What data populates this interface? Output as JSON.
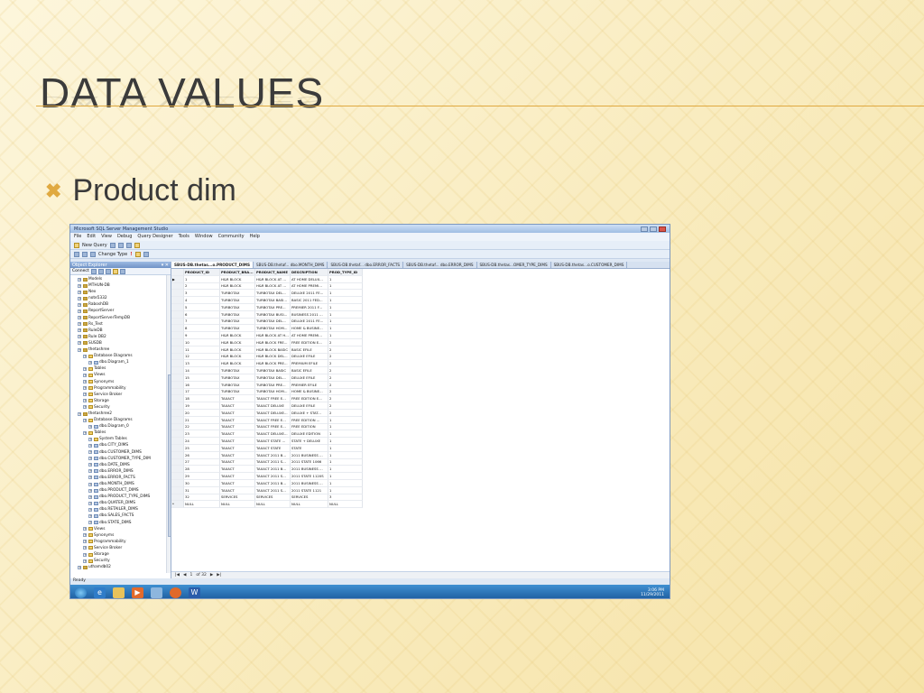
{
  "slide": {
    "title": "DATA VALUES",
    "bullet": "Product dim",
    "bullet_icon": "x-mark-icon",
    "accent": "#e0a940"
  },
  "ssms": {
    "window_title": "Microsoft SQL Server Management Studio",
    "menu": [
      "File",
      "Edit",
      "View",
      "Debug",
      "Query Designer",
      "Tools",
      "Window",
      "Community",
      "Help"
    ],
    "toolbar_new_query": "New Query",
    "toolbar_change_type": "Change Type",
    "explorer_title": "Object Explorer",
    "explorer_connect": "Connect",
    "tree": [
      {
        "label": "Models",
        "level": 2,
        "kind": "db"
      },
      {
        "label": "MTHUN-DB",
        "level": 2,
        "kind": "db"
      },
      {
        "label": "Nex",
        "level": 2,
        "kind": "db"
      },
      {
        "label": "note5332",
        "level": 2,
        "kind": "db"
      },
      {
        "label": "RaboshDB",
        "level": 2,
        "kind": "db"
      },
      {
        "label": "ReportServer",
        "level": 2,
        "kind": "db"
      },
      {
        "label": "ReportServerTempDB",
        "level": 2,
        "kind": "db"
      },
      {
        "label": "Rs_Test",
        "level": 2,
        "kind": "db"
      },
      {
        "label": "RuleDB",
        "level": 2,
        "kind": "db"
      },
      {
        "label": "Rule DB2",
        "level": 2,
        "kind": "db"
      },
      {
        "label": "SUSDB",
        "level": 2,
        "kind": "db"
      },
      {
        "label": "thetashree",
        "level": 2,
        "kind": "db"
      },
      {
        "label": "Database Diagrams",
        "level": 3,
        "kind": "folder"
      },
      {
        "label": "dbo.Diagram_1",
        "level": 4,
        "kind": "tbl"
      },
      {
        "label": "Tables",
        "level": 3,
        "kind": "folder"
      },
      {
        "label": "Views",
        "level": 3,
        "kind": "folder"
      },
      {
        "label": "Synonyms",
        "level": 3,
        "kind": "folder"
      },
      {
        "label": "Programmability",
        "level": 3,
        "kind": "folder"
      },
      {
        "label": "Service Broker",
        "level": 3,
        "kind": "folder"
      },
      {
        "label": "Storage",
        "level": 3,
        "kind": "folder"
      },
      {
        "label": "Security",
        "level": 3,
        "kind": "folder"
      },
      {
        "label": "thetashree2",
        "level": 2,
        "kind": "db"
      },
      {
        "label": "Database Diagrams",
        "level": 3,
        "kind": "folder"
      },
      {
        "label": "dbo.Diagram_0",
        "level": 4,
        "kind": "tbl"
      },
      {
        "label": "Tables",
        "level": 3,
        "kind": "folder"
      },
      {
        "label": "System Tables",
        "level": 4,
        "kind": "folder"
      },
      {
        "label": "dbo.CITY_DIMS",
        "level": 4,
        "kind": "tbl"
      },
      {
        "label": "dbo.CUSTOMER_DIMS",
        "level": 4,
        "kind": "tbl"
      },
      {
        "label": "dbo.CUSTOMER_TYPE_DIM",
        "level": 4,
        "kind": "tbl"
      },
      {
        "label": "dbo.DATE_DIMS",
        "level": 4,
        "kind": "tbl"
      },
      {
        "label": "dbo.ERROR_DIMS",
        "level": 4,
        "kind": "tbl"
      },
      {
        "label": "dbo.ERROR_FACTS",
        "level": 4,
        "kind": "tbl"
      },
      {
        "label": "dbo.MONTH_DIMS",
        "level": 4,
        "kind": "tbl"
      },
      {
        "label": "dbo.PRODUCT_DIMS",
        "level": 4,
        "kind": "tbl"
      },
      {
        "label": "dbo.PRODUCT_TYPE_DIMS",
        "level": 4,
        "kind": "tbl"
      },
      {
        "label": "dbo.QUATER_DIMS",
        "level": 4,
        "kind": "tbl"
      },
      {
        "label": "dbo.RETAILER_DIMS",
        "level": 4,
        "kind": "tbl"
      },
      {
        "label": "dbo.SALES_FACTS",
        "level": 4,
        "kind": "tbl"
      },
      {
        "label": "dbo.STATE_DIMS",
        "level": 4,
        "kind": "tbl"
      },
      {
        "label": "Views",
        "level": 3,
        "kind": "folder"
      },
      {
        "label": "Synonyms",
        "level": 3,
        "kind": "folder"
      },
      {
        "label": "Programmability",
        "level": 3,
        "kind": "folder"
      },
      {
        "label": "Service Broker",
        "level": 3,
        "kind": "folder"
      },
      {
        "label": "Storage",
        "level": 3,
        "kind": "folder"
      },
      {
        "label": "Security",
        "level": 3,
        "kind": "folder"
      },
      {
        "label": "uthamdb02",
        "level": 2,
        "kind": "db"
      }
    ],
    "tabs": [
      "SBUS-DB.thetas...o.PRODUCT_DIMS",
      "SBUS-DB.thetaf... dbo.MONTH_DIMS",
      "SBUS-DB.thetaf... dbo.ERROR_FACTS",
      "SBUS-DB.thetaf... dbo.ERROR_DIMS",
      "SBUS-DB.thetas...OMER_TYPE_DIMS",
      "SBUS-DB.thetas...o.CUSTOMER_DIMS"
    ],
    "columns": [
      "PRODUCT_ID",
      "PRODUCT_BRA...",
      "PRODUCT_NAME",
      "DESCRIPTION",
      "PROD_TYPE_ID"
    ],
    "rows": [
      [
        "1",
        "H&R BLOCK",
        "H&R BLOCK AT ...",
        "AT HOME DELUX...",
        "1"
      ],
      [
        "2",
        "H&R BLOCK",
        "H&R BLOCK AT ...",
        "AT HOME PREMI...",
        "1"
      ],
      [
        "3",
        "TURBOTAX",
        "TURBOTAX DEL...",
        "DELUXE 2011 FE...",
        "1"
      ],
      [
        "4",
        "TURBOTAX",
        "TURBOTAX BASI...",
        "BASIC 2011 FED...",
        "1"
      ],
      [
        "5",
        "TURBOTAX",
        "TURBOTAX PRE...",
        "PREMIER 2011 F...",
        "1"
      ],
      [
        "6",
        "TURBOTAX",
        "TURBOTAX BUSI...",
        "BUSINESS 2011 ...",
        "1"
      ],
      [
        "7",
        "TURBOTAX",
        "TURBOTAX DEL...",
        "DELUXE 2011 FE...",
        "1"
      ],
      [
        "8",
        "TURBOTAX",
        "TURBOTAX HOM...",
        "HOME & BUSINE...",
        "1"
      ],
      [
        "9",
        "H&R BLOCK",
        "H&R BLOCK AT H...",
        "AT HOME PREMI...",
        "1"
      ],
      [
        "10",
        "H&R BLOCK",
        "H&R BLOCK FRE...",
        "FREE EDITION E...",
        "2"
      ],
      [
        "11",
        "H&R BLOCK",
        "H&R BLOCK BASIC",
        "BASIC EFILE",
        "2"
      ],
      [
        "12",
        "H&R BLOCK",
        "H&R BLOCK DEL...",
        "DELUXE EFILE",
        "2"
      ],
      [
        "13",
        "H&R BLOCK",
        "H&R BLOCK PRE...",
        "PREMIUM EFILE",
        "2"
      ],
      [
        "14",
        "TURBOTAX",
        "TURBOTAX BASIC",
        "BASIC EFILE",
        "2"
      ],
      [
        "15",
        "TURBOTAX",
        "TURBOTAX DEL...",
        "DELUXE EFILE",
        "2"
      ],
      [
        "16",
        "TURBOTAX",
        "TURBOTAX PRE...",
        "PREMIER EFILE",
        "2"
      ],
      [
        "17",
        "TURBOTAX",
        "TURBOTAX HOM...",
        "HOME & BUSINE...",
        "2"
      ],
      [
        "18",
        "TAXACT",
        "TAXACT FREE E...",
        "FREE EDITION E...",
        "2"
      ],
      [
        "19",
        "TAXACT",
        "TAXACT DELUXE",
        "DELUXE EFILE",
        "2"
      ],
      [
        "20",
        "TAXACT",
        "TAXACT DELUXE...",
        "DELUXE + STAT...",
        "2"
      ],
      [
        "21",
        "TAXACT",
        "TAXACT FREE E...",
        "FREE EDITION ...",
        "1"
      ],
      [
        "22",
        "TAXACT",
        "TAXACT FREE E...",
        "FREE EDITION",
        "1"
      ],
      [
        "23",
        "TAXACT",
        "TAXACT DELUXE...",
        "DELUXE EDITION",
        "1"
      ],
      [
        "24",
        "TAXACT",
        "TAXACT STATE ...",
        "STATE + DELUXE",
        "1"
      ],
      [
        "25",
        "TAXACT",
        "TAXACT STATE",
        "STATE",
        "1"
      ],
      [
        "26",
        "TAXACT",
        "TAXACT 2011 B...",
        "2011 BUSINESS ...",
        "1"
      ],
      [
        "27",
        "TAXACT",
        "TAXACT 2011 S...",
        "2011 STATE 1066",
        "1"
      ],
      [
        "28",
        "TAXACT",
        "TAXACT 2011 B...",
        "2011 BUSINESS ...",
        "1"
      ],
      [
        "29",
        "TAXACT",
        "TAXACT 2011 S...",
        "2011 STATE 1120S",
        "1"
      ],
      [
        "30",
        "TAXACT",
        "TAXACT 2011 B...",
        "2011 BUSINESS ...",
        "1"
      ],
      [
        "31",
        "TAXACT",
        "TAXACT 2011 S...",
        "2011 STATE 1121",
        "1"
      ],
      [
        "32",
        "SERVICES",
        "SERVICES",
        "SERVICES",
        "3"
      ],
      [
        "NULL",
        "NULL",
        "NULL",
        "NULL",
        "NULL"
      ]
    ],
    "nav": {
      "page": "1",
      "of": "of 32"
    },
    "status": "Ready",
    "clock_time": "3:06 PM",
    "clock_date": "11/29/2011"
  }
}
